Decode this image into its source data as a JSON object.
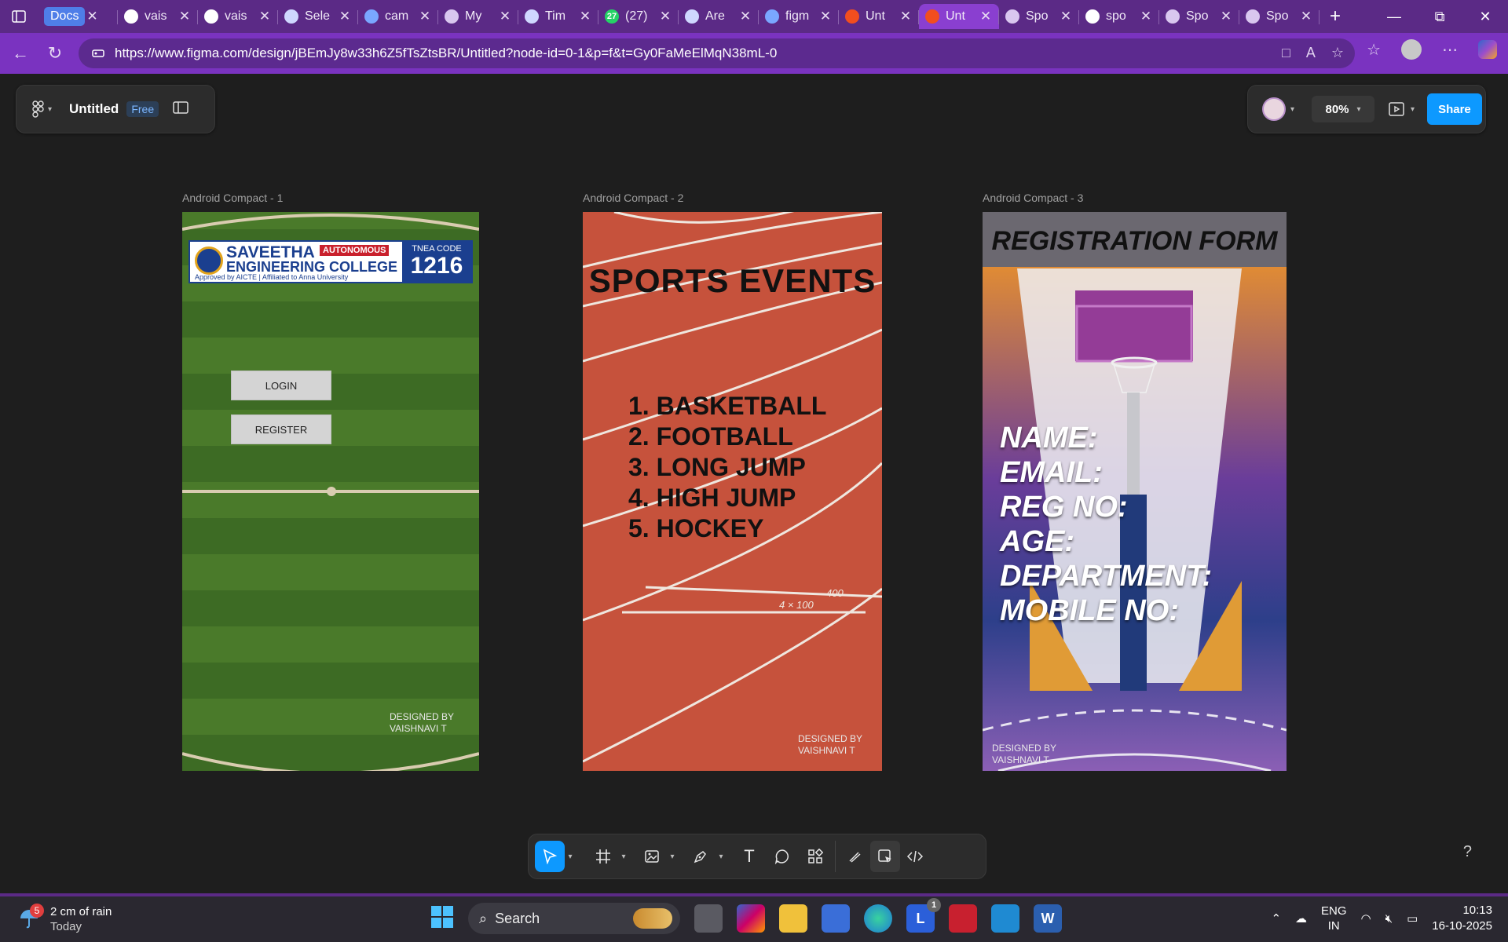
{
  "tabs": [
    {
      "title": "Docs",
      "icon": "docs-icon"
    },
    {
      "title": "vais",
      "icon": "github-icon"
    },
    {
      "title": "vais",
      "icon": "github-icon"
    },
    {
      "title": "Sele",
      "icon": "globe-icon"
    },
    {
      "title": "cam",
      "icon": "search-icon"
    },
    {
      "title": "My",
      "icon": "page-icon"
    },
    {
      "title": "Tim",
      "icon": "globe-icon"
    },
    {
      "title": "(27)",
      "icon": "whatsapp-icon",
      "badge": "27"
    },
    {
      "title": "Are",
      "icon": "globe-icon"
    },
    {
      "title": "figm",
      "icon": "search-icon"
    },
    {
      "title": "Unt",
      "icon": "figma-icon"
    },
    {
      "title": "Unt",
      "icon": "figma-icon",
      "active": true
    },
    {
      "title": "Spo",
      "icon": "page-icon"
    },
    {
      "title": "spo",
      "icon": "google-icon"
    },
    {
      "title": "Spo",
      "icon": "page-icon"
    },
    {
      "title": "Spo",
      "icon": "page-icon"
    }
  ],
  "address": {
    "url": "https://www.figma.com/design/jBEmJy8w33h6Z5fTsZtsBR/Untitled?node-id=0-1&p=f&t=Gy0FaMeElMqN38mL-0"
  },
  "figma": {
    "file_name": "Untitled",
    "plan_badge": "Free",
    "zoom": "80%",
    "share_label": "Share",
    "help": "?",
    "frames": [
      {
        "label": "Android Compact - 1",
        "logo": {
          "name": "SAVEETHA",
          "line2": "ENGINEERING COLLEGE",
          "autonomous": "AUTONOMOUS",
          "tnea": "TNEA CODE",
          "code": "1216",
          "approval": "Approved by AICTE | Affiliated to Anna University"
        },
        "login": "LOGIN",
        "register": "REGISTER",
        "designer_line1": "DESIGNED BY",
        "designer_line2": "VAISHNAVI T"
      },
      {
        "label": "Android Compact - 2",
        "title": "SPORTS EVENTS",
        "events": [
          "1. BASKETBALL",
          "2. FOOTBALL",
          "3. LONG JUMP",
          "4. HIGH JUMP",
          "5. HOCKEY"
        ],
        "track_mark1": "400",
        "track_mark2": "4 × 100",
        "designer_line1": "DESIGNED BY",
        "designer_line2": "VAISHNAVI T"
      },
      {
        "label": "Android Compact - 3",
        "title": "REGISTRATION FORM",
        "fields": [
          "NAME:",
          "EMAIL:",
          "REG NO:",
          "AGE:",
          "DEPARTMENT:",
          "MOBILE NO:"
        ],
        "designer_line1": "DESIGNED BY",
        "designer_line2": "VAISHNAVI T"
      }
    ]
  },
  "taskbar": {
    "weather_badge": "5",
    "weather_line1": "2 cm of rain",
    "weather_line2": "Today",
    "search_label": "Search",
    "mail_badge": "1",
    "lang_line1": "ENG",
    "lang_line2": "IN",
    "time": "10:13",
    "date": "16-10-2025"
  }
}
